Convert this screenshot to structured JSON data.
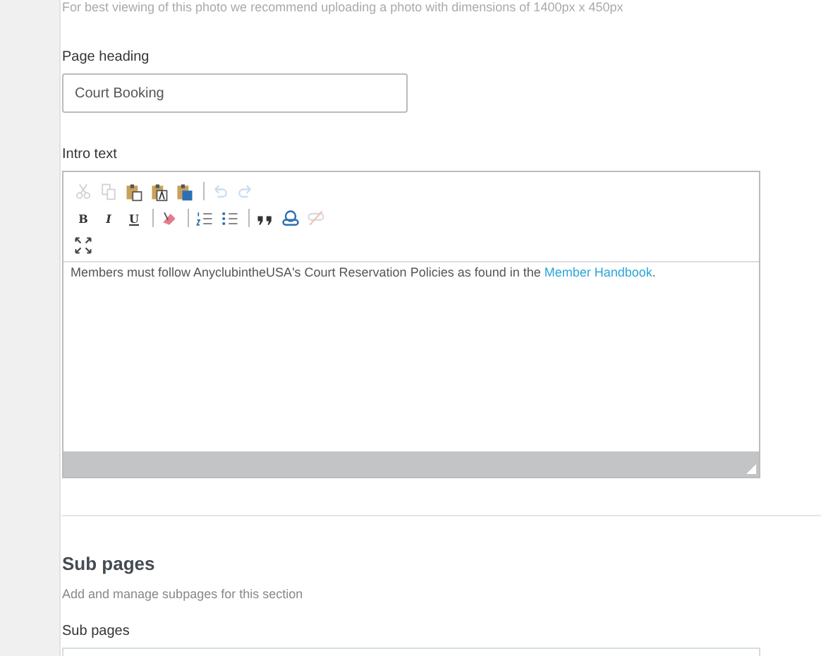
{
  "photo_hint": "For best viewing of this photo we recommend uploading a photo with dimensions of 1400px x 450px",
  "page_heading": {
    "label": "Page heading",
    "value": "Court Booking"
  },
  "intro": {
    "label": "Intro text",
    "toolbar": [
      [
        [
          {
            "kind": "cut",
            "disabled": true
          },
          {
            "kind": "copy",
            "disabled": true
          },
          {
            "kind": "paste",
            "disabled": false
          },
          {
            "kind": "paste-text",
            "disabled": false
          },
          {
            "kind": "paste-word",
            "disabled": false
          }
        ],
        [
          {
            "kind": "undo",
            "disabled": true
          },
          {
            "kind": "redo",
            "disabled": true
          }
        ]
      ],
      [
        [
          {
            "kind": "bold",
            "label": "B",
            "disabled": false
          },
          {
            "kind": "italic",
            "label": "I",
            "disabled": false
          },
          {
            "kind": "underline",
            "label": "U",
            "disabled": false
          }
        ],
        [
          {
            "kind": "remove-format",
            "disabled": false
          }
        ],
        [
          {
            "kind": "numbered-list",
            "disabled": false
          },
          {
            "kind": "bulleted-list",
            "disabled": false
          }
        ],
        [
          {
            "kind": "blockquote",
            "disabled": false
          },
          {
            "kind": "link",
            "disabled": false
          },
          {
            "kind": "unlink",
            "disabled": true
          }
        ]
      ],
      [
        [
          {
            "kind": "maximize",
            "disabled": false
          }
        ]
      ]
    ],
    "content": "Members must follow AnyclubintheUSA's Court Reservation Policies as found in the ",
    "link": "Member Handbook",
    "content_end": "."
  },
  "sub_pages": {
    "title": "Sub pages",
    "description": "Add and manage subpages for this section",
    "label": "Sub pages"
  }
}
